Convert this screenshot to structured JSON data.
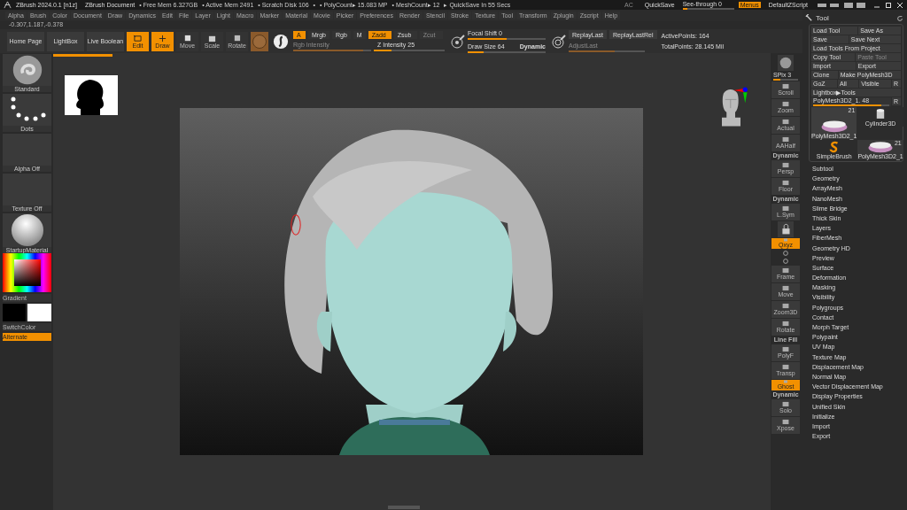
{
  "title_bar": {
    "app": "ZBrush 2024.0.1 [n1z]",
    "document": "ZBrush Document",
    "stats": [
      "• Free Mem 6.327GB",
      "• Active Mem 2491",
      "• Scratch Disk 106",
      "•",
      "• PolyCount▸ 15.083 MP",
      "• MeshCount▸ 12",
      "▸ QuickSave In 55 Secs"
    ],
    "ac": {
      "label": "AC",
      "disabled": true
    },
    "quicksave": "QuickSave",
    "see_through": {
      "label": "See-through  0",
      "level": 0.1
    },
    "menus": {
      "label": "Menus",
      "selected": true
    },
    "script": "DefaultZScript"
  },
  "menu_bar": [
    "Alpha",
    "Brush",
    "Color",
    "Document",
    "Draw",
    "Dynamics",
    "Edit",
    "File",
    "Layer",
    "Light",
    "Macro",
    "Marker",
    "Material",
    "Movie",
    "Picker",
    "Preferences",
    "Render",
    "Stencil",
    "Stroke",
    "Texture",
    "Tool",
    "Transform",
    "Zplugin",
    "Zscript",
    "Help"
  ],
  "coordinates": "-0.307,1.187,-0.378",
  "toolbar": {
    "nav": [
      "Home Page",
      "LightBox",
      "Live Boolean"
    ],
    "modes": [
      {
        "label": "Edit",
        "kind": "edit",
        "selected": true
      },
      {
        "label": "Draw",
        "kind": "draw",
        "selected": true
      },
      {
        "label": "Move",
        "kind": "move",
        "selected": false
      },
      {
        "label": "Scale",
        "kind": "scale",
        "selected": false
      },
      {
        "label": "Rotate",
        "kind": "rotate",
        "selected": false
      }
    ],
    "channels": [
      {
        "label": "A",
        "selected": true
      },
      {
        "label": "Mrgb",
        "selected": false
      },
      {
        "label": "Rgb",
        "selected": false
      },
      {
        "label": "M",
        "selected": false
      }
    ],
    "rgb_intensity": {
      "label": "Rgb Intensity",
      "level": 0.9,
      "disabled": true
    },
    "z_modes": [
      {
        "label": "Zadd",
        "selected": true,
        "disabled": false
      },
      {
        "label": "Zsub",
        "selected": false,
        "disabled": false
      },
      {
        "label": "Zcut",
        "selected": false,
        "disabled": true
      }
    ],
    "z_intensity": {
      "label": "Z Intensity 25",
      "level": 0.25
    },
    "focal_shift": {
      "label": "Focal Shift 0",
      "level": 0.5
    },
    "draw_size": {
      "label": "Draw Size 64",
      "level": 0.2,
      "dynamic": "Dynamic"
    },
    "replay": [
      "ReplayLast",
      "ReplayLastRel"
    ],
    "adjust_last": {
      "label": "AdjustLast",
      "level": 0.6,
      "disabled": true
    },
    "active_points": "ActivePoints: 164",
    "total_points": "TotalPoints: 28.145 Mil"
  },
  "left_shelf": {
    "items": [
      {
        "label": "Standard",
        "kind": "brush"
      },
      {
        "label": "Dots",
        "kind": "stroke"
      },
      {
        "label": "Alpha Off",
        "kind": "empty"
      },
      {
        "label": "Texture Off",
        "kind": "empty"
      },
      {
        "label": "StartupMaterial",
        "kind": "material"
      }
    ],
    "gradient": "Gradient",
    "switch_color": "SwitchColor",
    "alternate": {
      "label": "Alternate",
      "selected": true
    }
  },
  "canvas": {
    "progress": {
      "level": 0.083
    }
  },
  "right_shelf": [
    {
      "kind": "sphere"
    },
    {
      "kind": "slider",
      "label": "SPix 3",
      "level": 0.3
    },
    {
      "kind": "button",
      "label": "Scroll"
    },
    {
      "kind": "button",
      "label": "Zoom"
    },
    {
      "kind": "button",
      "label": "Actual"
    },
    {
      "kind": "button",
      "label": "AAHalf"
    },
    {
      "kind": "button",
      "label": "Persp",
      "caption": "Dynamic"
    },
    {
      "kind": "button",
      "label": "Floor"
    },
    {
      "kind": "button",
      "label": "L.Sym",
      "caption": "Dynamic"
    },
    {
      "kind": "lock"
    },
    {
      "kind": "toggle",
      "label": "Qxyz",
      "selected": true
    },
    {
      "kind": "small"
    },
    {
      "kind": "small"
    },
    {
      "kind": "button",
      "label": "Frame"
    },
    {
      "kind": "button",
      "label": "Move"
    },
    {
      "kind": "button",
      "label": "Zoom3D"
    },
    {
      "kind": "button",
      "label": "Rotate"
    },
    {
      "kind": "button",
      "label": "PolyF",
      "caption": "Line Fill"
    },
    {
      "kind": "button",
      "label": "Transp"
    },
    {
      "kind": "toggle",
      "label": "Ghost",
      "selected": true
    },
    {
      "kind": "button",
      "label": "Solo",
      "caption": "Dynamic"
    },
    {
      "kind": "button",
      "label": "Xpose"
    }
  ],
  "tool_panel": {
    "title": "Tool",
    "button_rows": [
      [
        {
          "label": "Load Tool",
          "disabled": false
        },
        {
          "label": "Save As",
          "disabled": false
        }
      ],
      [
        {
          "label": "Save",
          "disabled": false
        },
        {
          "label": "Save Next",
          "disabled": false
        }
      ],
      [
        {
          "label": "Load Tools From Project",
          "disabled": false
        }
      ],
      [
        {
          "label": "Copy Tool",
          "disabled": false
        },
        {
          "label": "Paste Tool",
          "disabled": true
        }
      ],
      [
        {
          "label": "Import",
          "disabled": false
        },
        {
          "label": "Export",
          "disabled": false
        }
      ],
      [
        {
          "label": "Clone",
          "disabled": false
        },
        {
          "label": "Make PolyMesh3D",
          "disabled": false
        }
      ],
      [
        {
          "label": "GoZ",
          "disabled": false
        },
        {
          "label": "All",
          "disabled": false
        },
        {
          "label": "Visible",
          "disabled": false
        },
        {
          "label": "R",
          "disabled": false
        }
      ],
      [
        {
          "label": "Lightbox▶Tools",
          "disabled": false
        }
      ]
    ],
    "mesh_slider": {
      "label": "PolyMesh3D2_1. 48",
      "level": 0.9,
      "reset": "R"
    },
    "thumbnails": [
      {
        "label": "PolyMesh3D2_1",
        "count": "21",
        "kind": "pill",
        "selected": true
      },
      {
        "label": "Cylinder3D",
        "kind": "cylinder",
        "selected": false
      },
      {
        "label": "SimpleBrush",
        "kind": "brush",
        "selected": false
      },
      {
        "label": "PolyMesh3D2_1",
        "count": "21",
        "kind": "pill",
        "selected": false
      }
    ],
    "sections": [
      "Subtool",
      "Geometry",
      "ArrayMesh",
      "NanoMesh",
      "Slime Bridge",
      "Thick Skin",
      "Layers",
      "FiberMesh",
      "Geometry HD",
      "Preview",
      "Surface",
      "Deformation",
      "Masking",
      "Visibility",
      "Polygroups",
      "Contact",
      "Morph Target",
      "Polypaint",
      "UV Map",
      "Texture Map",
      "Displacement Map",
      "Normal Map",
      "Vector Displacement Map",
      "Display Properties",
      "Unified Skin",
      "Initialize",
      "Import",
      "Export"
    ]
  }
}
